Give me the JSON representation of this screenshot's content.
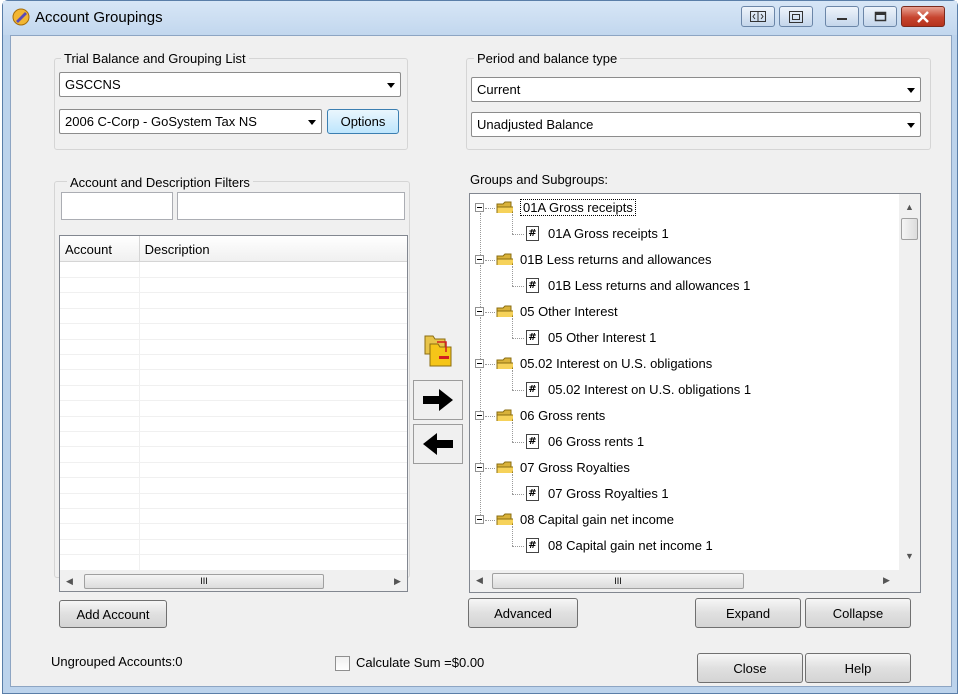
{
  "window": {
    "title": "Account Groupings"
  },
  "trial_balance": {
    "group_label": "Trial Balance and Grouping List",
    "selected": "GSCCNS",
    "grouping_list": "2006 C-Corp - GoSystem Tax NS",
    "options_label": "Options"
  },
  "period": {
    "group_label": "Period and balance type",
    "period_value": "Current",
    "balance_type": "Unadjusted Balance"
  },
  "filters": {
    "group_label": "Account and Description Filters"
  },
  "accounts_list": {
    "col_account": "Account",
    "col_description": "Description"
  },
  "add_account_label": "Add Account",
  "groups": {
    "label": "Groups and Subgroups:",
    "items": [
      {
        "group": "01A  Gross receipts",
        "sub": "01A  Gross receipts 1"
      },
      {
        "group": "01B  Less returns and allowances",
        "sub": "01B  Less returns and allowances 1"
      },
      {
        "group": "05  Other Interest",
        "sub": "05  Other Interest 1"
      },
      {
        "group": "05.02  Interest on U.S. obligations",
        "sub": "05.02  Interest on U.S. obligations 1"
      },
      {
        "group": "06  Gross rents",
        "sub": "06  Gross rents 1"
      },
      {
        "group": "07  Gross Royalties",
        "sub": "07  Gross Royalties 1"
      },
      {
        "group": "08  Capital gain net income",
        "sub": "08  Capital gain net income 1"
      }
    ]
  },
  "advanced_label": "Advanced",
  "expand_label": "Expand",
  "collapse_label": "Collapse",
  "ungrouped": "Ungrouped Accounts:0",
  "calc_sum": "Calculate Sum =$0.00",
  "close_label": "Close",
  "help_label": "Help",
  "icons": {
    "tree_doc_glyph": "#",
    "scroll_thumb_glyph": "III"
  }
}
